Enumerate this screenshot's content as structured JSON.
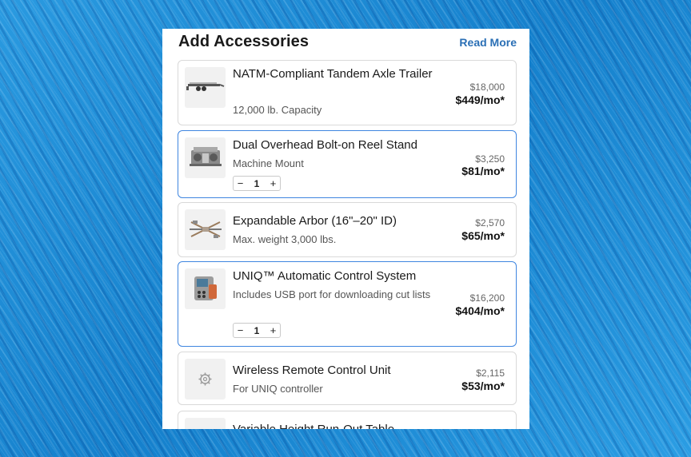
{
  "header": {
    "title": "Add Accessories",
    "read_more": "Read More"
  },
  "items": [
    {
      "name": "NATM-Compliant Tandem Axle Trailer",
      "subtitle": "12,000 lb. Capacity",
      "price": "$18,000",
      "monthly": "$449/mo*",
      "icon": "trailer-icon",
      "selected": false
    },
    {
      "name": "Dual Overhead Bolt-on Reel Stand",
      "subtitle": "Machine Mount",
      "price": "$3,250",
      "monthly": "$81/mo*",
      "icon": "reel-stand-icon",
      "selected": true,
      "quantity": "1",
      "minus": "−",
      "plus": "+"
    },
    {
      "name": "Expandable Arbor (16\"–20\" ID)",
      "subtitle": "Max. weight 3,000 lbs.",
      "price": "$2,570",
      "monthly": "$65/mo*",
      "icon": "arbor-icon",
      "selected": false
    },
    {
      "name": "UNIQ™ Automatic Control System",
      "subtitle": "Includes USB port for downloading cut lists",
      "price": "$16,200",
      "monthly": "$404/mo*",
      "icon": "control-system-icon",
      "selected": true,
      "quantity": "1",
      "minus": "−",
      "plus": "+"
    },
    {
      "name": "Wireless Remote Control Unit",
      "subtitle": "For UNIQ controller",
      "price": "$2,115",
      "monthly": "$53/mo*",
      "icon": "gear-icon",
      "selected": false
    },
    {
      "name": "Variable Height Run-Out Table",
      "icon": "run-out-table-icon",
      "selected": false
    }
  ],
  "colors": {
    "accent": "#3f86e0",
    "link": "#2a6fb5",
    "background": "#1f8fd6"
  }
}
